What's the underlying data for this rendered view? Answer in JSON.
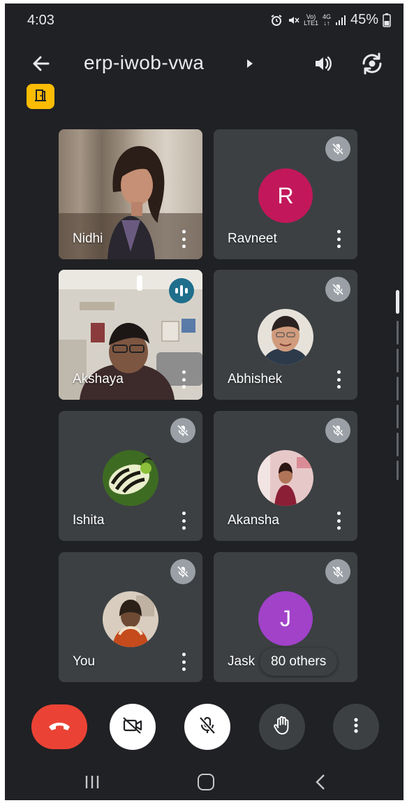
{
  "status_bar": {
    "time": "4:03",
    "network_top": "Vo)",
    "network_bottom": "LTE1",
    "data_top": "4G",
    "data_bottom": "↓↑",
    "battery": "45%"
  },
  "header": {
    "meeting_code": "erp-iwob-vwa"
  },
  "tiles": [
    {
      "name": "Nidhi"
    },
    {
      "name": "Ravneet",
      "avatar_letter": "R",
      "avatar_color": "#c2185b"
    },
    {
      "name": "Akshaya"
    },
    {
      "name": "Abhishek"
    },
    {
      "name": "Ishita"
    },
    {
      "name": "Akansha"
    },
    {
      "name": "You"
    },
    {
      "name": "Jask",
      "avatar_letter": "J",
      "avatar_color": "#a142c9"
    }
  ],
  "others_chip": "80 others",
  "colors": {
    "background": "#202124",
    "tile": "#3c4043",
    "end_call": "#ea4335",
    "room_badge": "#fbbc04",
    "active_speaker": "#1e6e8c"
  },
  "icons": {
    "back": "arrow-left-icon",
    "speaker": "volume-icon",
    "camera_switch": "camera-switch-icon",
    "room": "door-icon",
    "muted": "mic-off-icon",
    "speaking": "audio-wave-icon",
    "end_call": "phone-hangup-icon",
    "camera": "video-off-icon",
    "mic": "mic-off-icon",
    "raise_hand": "hand-icon",
    "more": "more-vertical-icon"
  }
}
